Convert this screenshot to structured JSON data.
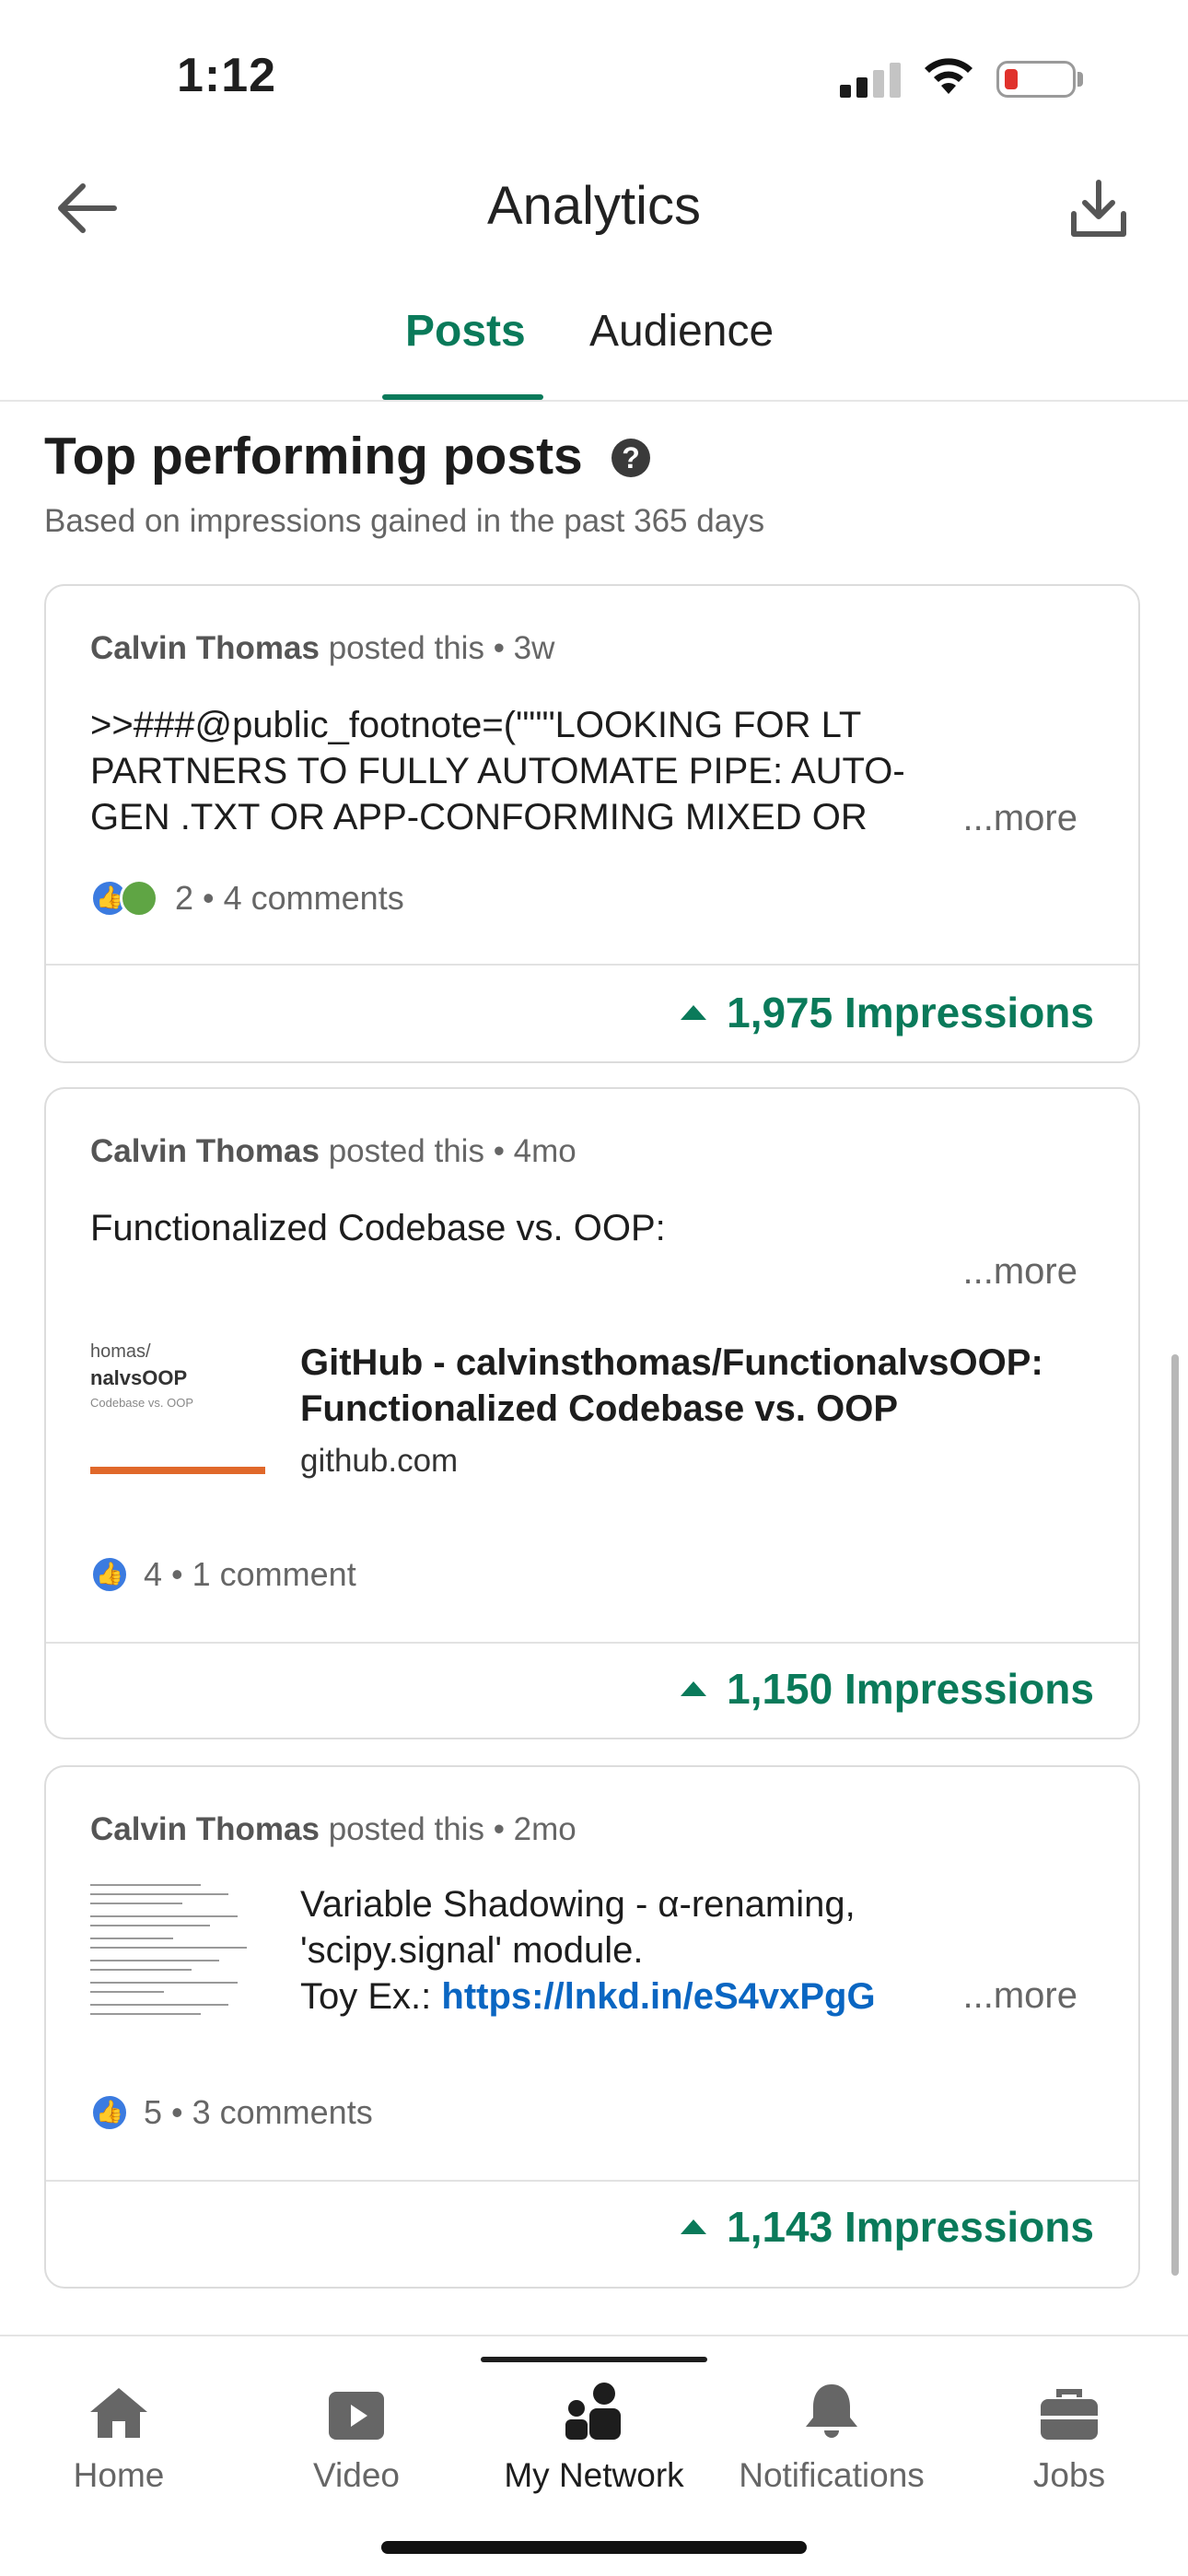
{
  "status": {
    "time": "1:12"
  },
  "header": {
    "title": "Analytics"
  },
  "tabs": [
    {
      "label": "Posts",
      "active": true
    },
    {
      "label": "Audience",
      "active": false
    }
  ],
  "section": {
    "title": "Top performing posts",
    "subtitle": "Based on impressions gained in the past 365 days"
  },
  "posts": [
    {
      "author": "Calvin Thomas",
      "action": "posted this",
      "age": "3w",
      "lines": [
        ">>###@public_footnote=(\"\"\"LOOKING FOR LT",
        "PARTNERS TO FULLY AUTOMATE PIPE: AUTO-",
        "GEN .TXT OR APP-CONFORMING MIXED OR"
      ],
      "more": "...more",
      "reactions": "2 • 4 comments",
      "impressions": "1,975 Impressions"
    },
    {
      "author": "Calvin Thomas",
      "action": "posted this",
      "age": "4mo",
      "text": "Functionalized Codebase vs. OOP:",
      "more": "...more",
      "link_title": "GitHub - calvinsthomas/FunctionalvsOOP: Functionalized Codebase vs. OOP",
      "link_domain": "github.com",
      "thumb_lines": [
        "homas/",
        "nalvsOOP",
        "Codebase vs. OOP"
      ],
      "reactions": "4 • 1 comment",
      "impressions": "1,150 Impressions"
    },
    {
      "author": "Calvin Thomas",
      "action": "posted this",
      "age": "2mo",
      "lines": [
        "Variable Shadowing - α-renaming,",
        "'scipy.signal' module."
      ],
      "toy_prefix": "Toy Ex.: ",
      "toy_link": "https://lnkd.in/eS4vxPgG",
      "more": "...more",
      "reactions": "5 • 3 comments",
      "impressions": "1,143 Impressions"
    }
  ],
  "nav": [
    {
      "label": "Home",
      "icon": "home-icon"
    },
    {
      "label": "Video",
      "icon": "video-icon"
    },
    {
      "label": "My Network",
      "icon": "network-icon",
      "active": true
    },
    {
      "label": "Notifications",
      "icon": "bell-icon"
    },
    {
      "label": "Jobs",
      "icon": "briefcase-icon"
    }
  ],
  "colors": {
    "accent": "#0a7a5a",
    "link": "#0a66c2",
    "battery_low": "#e0312b"
  }
}
